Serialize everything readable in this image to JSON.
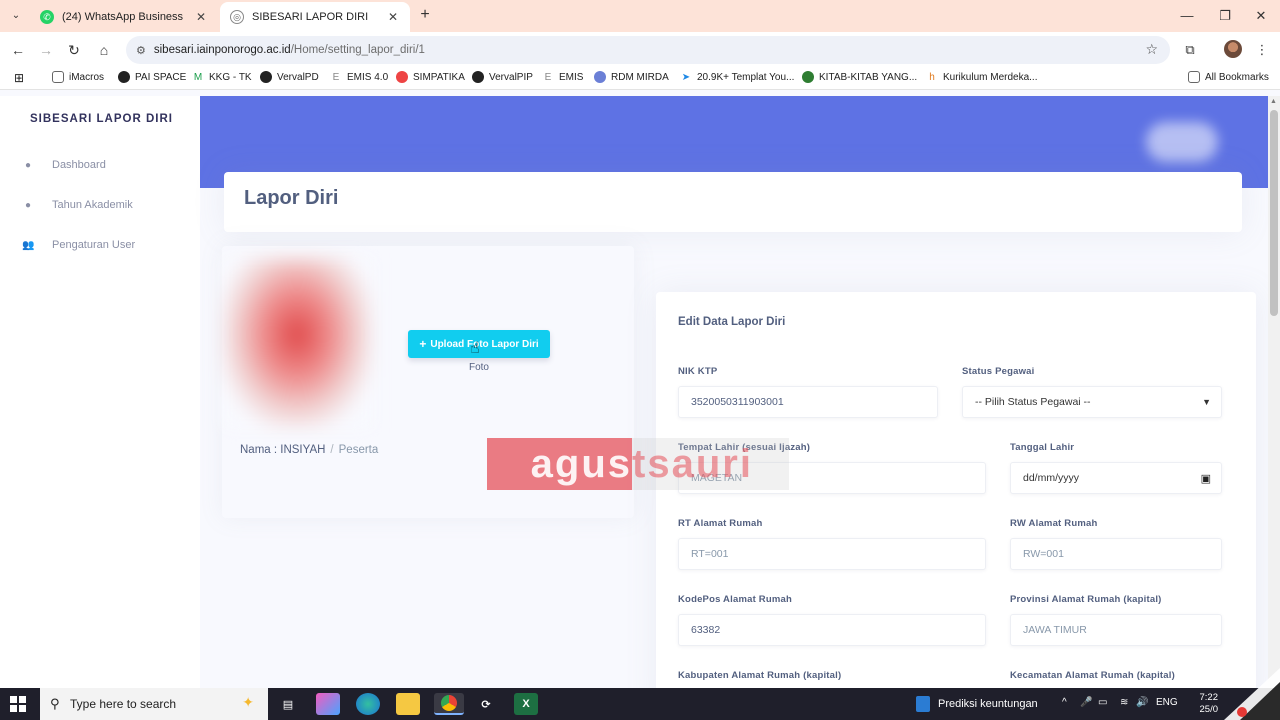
{
  "browser": {
    "tabs": [
      {
        "title": "(24) WhatsApp Business",
        "active": false
      },
      {
        "title": "SIBESARI LAPOR DIRI",
        "active": true
      }
    ],
    "url_host": "sibesari.iainponorogo.ac.id",
    "url_path": "/Home/setting_lapor_diri/1",
    "bookmarks": [
      "iMacros",
      "PAI SPACE",
      "KKG - TK",
      "VervalPD",
      "EMIS 4.0",
      "SIMPATIKA",
      "VervalPIP",
      "EMIS",
      "RDM MIRDA",
      "20.9K+ Templat You...",
      "KITAB-KITAB YANG...",
      "Kurikulum Merdeka..."
    ],
    "all_bookmarks": "All Bookmarks"
  },
  "sidebar": {
    "brand": "SIBESARI LAPOR DIRI",
    "items": [
      {
        "label": "Dashboard",
        "icon": "drop-icon"
      },
      {
        "label": "Tahun Akademik",
        "icon": "drop-icon"
      },
      {
        "label": "Pengaturan User",
        "icon": "users-icon"
      }
    ]
  },
  "page": {
    "title": "Lapor Diri",
    "upload_button": "Upload Foto Lapor Diri",
    "foto_label": "Foto",
    "nama_prefix": "Nama : INSIYAH",
    "role": "Peserta"
  },
  "form": {
    "heading": "Edit Data Lapor Diri",
    "nik_label": "NIK KTP",
    "nik_value": "3520050311903001",
    "status_label": "Status Pegawai",
    "status_value": "-- Pilih Status Pegawai --",
    "tempat_label": "Tempat Lahir (sesuai Ijazah)",
    "tempat_placeholder": "MAGETAN",
    "tanggal_label": "Tanggal Lahir",
    "tanggal_placeholder": "dd/mm/yyyy",
    "rt_label": "RT Alamat Rumah",
    "rt_placeholder": "RT=001",
    "rw_label": "RW Alamat Rumah",
    "rw_placeholder": "RW=001",
    "kodepos_label": "KodePos Alamat Rumah",
    "kodepos_value": "63382",
    "provinsi_label": "Provinsi Alamat Rumah (kapital)",
    "provinsi_placeholder": "JAWA TIMUR",
    "kabupaten_label": "Kabupaten Alamat Rumah (kapital)",
    "kecamatan_label": "Kecamatan Alamat Rumah (kapital)"
  },
  "watermark": {
    "left": "agus",
    "right": "tsauri"
  },
  "taskbar": {
    "search_placeholder": "Type here to search",
    "notification": "Prediksi keuntungan",
    "language": "ENG",
    "time": "7:22",
    "date": "25/0"
  }
}
